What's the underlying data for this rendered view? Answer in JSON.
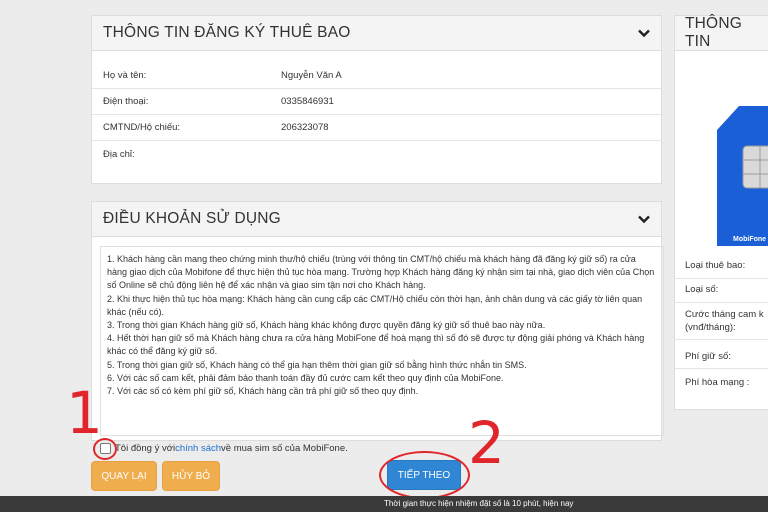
{
  "subscriber_panel": {
    "title": "THÔNG TIN ĐĂNG KÝ THUÊ BAO",
    "rows": [
      {
        "label": "Họ và tên:",
        "value": "Nguyễn Văn A"
      },
      {
        "label": "Điện thoại:",
        "value": "0335846931"
      },
      {
        "label": "CMTND/Hộ chiếu:",
        "value": "206323078"
      },
      {
        "label": "Địa chỉ:",
        "value": ""
      }
    ]
  },
  "terms_panel": {
    "title": "ĐIỀU KHOẢN SỬ DỤNG",
    "items": [
      "1. Khách hàng cần mang theo chứng minh thư/hộ chiếu (trùng với thông tin CMT/hộ chiếu mà khách hàng đã đăng ký giữ số) ra cửa hàng giao dịch của Mobifone để thực hiện thủ tục hòa mạng. Trường hợp Khách hàng đăng ký nhận sim tại nhà, giao dịch viên của Chọn số Online sẽ chủ động liên hệ để xác nhận và giao sim tận nơi cho Khách hàng.",
      "2. Khi thực hiện thủ tục hòa mạng: Khách hàng cần cung cấp các CMT/Hộ chiếu còn thời hạn, ảnh chân dung và các giấy tờ liên quan khác (nếu có).",
      "3. Trong thời gian Khách hàng giữ số, Khách hàng khác không được quyền đăng ký giữ số thuê bao này nữa.",
      "4. Hết thời hạn giữ số mà Khách hàng chưa ra cửa hàng MobiFone để hoà mạng thì số đó sẽ được tự động giải phóng và Khách hàng khác có thể đăng ký giữ số.",
      "5. Trong thời gian giữ số, Khách hàng có thể gia hạn thêm thời gian giữ số bằng hình thức nhắn tin SMS.",
      "6. Với các số cam kết, phải đảm bảo thanh toán đầy đủ cước cam kết theo quy định của MobiFone.",
      "7. Với các số có kèm phí giữ số, Khách hàng cần trả phí giữ số theo quy định."
    ]
  },
  "agree": {
    "prefix": "Tôi đồng ý với ",
    "link": "chính sách",
    "suffix": " về mua sim số của MobiFone."
  },
  "buttons": {
    "back": "QUAY LẠI",
    "cancel": "HỦY BỎ",
    "next": "TIẾP THEO"
  },
  "annotations": {
    "step1": "1",
    "step2": "2",
    "color": "#e0262a"
  },
  "side_panel": {
    "title": "THÔNG TIN",
    "sim_brand": "MobiFone",
    "rows": [
      "Loại thuê bao:",
      "Loại số:",
      "Cước tháng cam k",
      "(vnđ/tháng):",
      "Phí giữ số:",
      "Phí hòa mạng :"
    ]
  },
  "footer": {
    "text": "Thời gian thực hiện nhiệm đặt số là 10 phút, hiện nay"
  },
  "colors": {
    "orange": "#f0ad4e",
    "blue": "#2e86d4",
    "link": "#1e6fd0",
    "sim_blue": "#1a5fd6"
  }
}
